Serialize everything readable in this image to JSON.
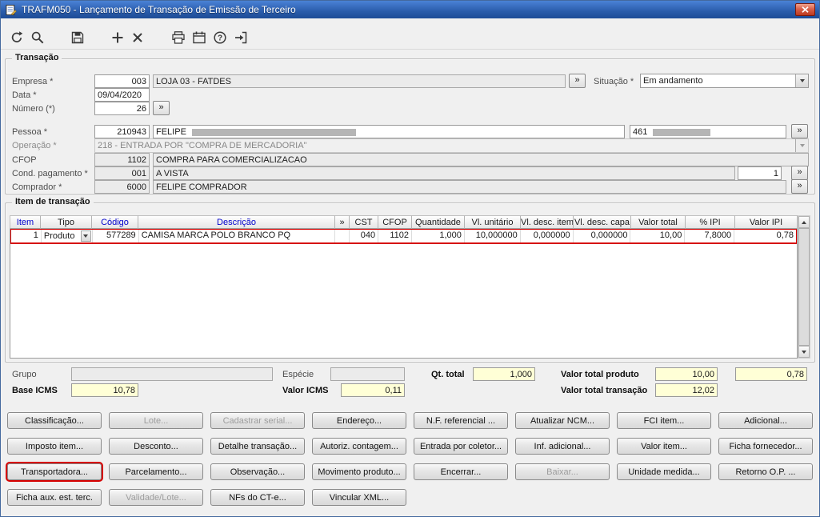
{
  "window": {
    "title": "TRAFM050 - Lançamento de Transação de Emissão de Terceiro"
  },
  "glyphs": {
    "expand": "»"
  },
  "toolbar": {
    "buttons": [
      "undo",
      "search",
      "save",
      "add",
      "delete",
      "print",
      "calendar",
      "help",
      "exit"
    ]
  },
  "transacao": {
    "legend": "Transação",
    "empresa": {
      "label": "Empresa *",
      "code": "003",
      "name": "LOJA 03 - FATDES"
    },
    "situacao": {
      "label": "Situação *",
      "value": "Em andamento"
    },
    "data": {
      "label": "Data *",
      "value": "09/04/2020"
    },
    "numero": {
      "label": "Número (*)",
      "value": "26"
    },
    "pessoa": {
      "label": "Pessoa *",
      "code": "210943",
      "name": "FELIPE",
      "doc": "461"
    },
    "operacao": {
      "label": "Operação *",
      "value": "218 - ENTRADA POR \"COMPRA DE MERCADORIA\""
    },
    "cfop": {
      "label": "CFOP",
      "code": "1102",
      "desc": "COMPRA PARA COMERCIALIZACAO"
    },
    "cond_pagamento": {
      "label": "Cond. pagamento *",
      "code": "001",
      "desc": "A VISTA",
      "parcelas": "1"
    },
    "comprador": {
      "label": "Comprador *",
      "code": "6000",
      "name": "FELIPE COMPRADOR"
    }
  },
  "itens": {
    "legend": "Item de transação",
    "columns": [
      {
        "label": "Item",
        "link": true
      },
      {
        "label": "Tipo",
        "link": false
      },
      {
        "label": "Código",
        "link": true
      },
      {
        "label": "Descrição",
        "link": true
      },
      {
        "label": "»",
        "link": false
      },
      {
        "label": "CST",
        "link": false
      },
      {
        "label": "CFOP",
        "link": false
      },
      {
        "label": "Quantidade",
        "link": false
      },
      {
        "label": "Vl. unitário",
        "link": false
      },
      {
        "label": "Vl. desc. item",
        "link": false
      },
      {
        "label": "Vl. desc. capa",
        "link": false
      },
      {
        "label": "Valor total",
        "link": false
      },
      {
        "label": "% IPI",
        "link": false
      },
      {
        "label": "Valor IPI",
        "link": false
      }
    ],
    "rows": [
      {
        "item": "1",
        "tipo": "Produto",
        "codigo": "577289",
        "descricao": "CAMISA MARCA POLO BRANCO PQ",
        "expand": "",
        "cst": "040",
        "cfop": "1102",
        "quantidade": "1,000",
        "vl_unitario": "10,000000",
        "vl_desc_item": "0,000000",
        "vl_desc_capa": "0,000000",
        "valor_total": "10,00",
        "pct_ipi": "7,8000",
        "valor_ipi": "0,78",
        "highlighted": true
      }
    ]
  },
  "totais": {
    "grupo_label": "Grupo",
    "grupo_value": "",
    "especie_label": "Espécie",
    "especie_value": "",
    "qt_total_label": "Qt. total",
    "qt_total": "1,000",
    "valor_total_produto_label": "Valor total produto",
    "valor_total_produto": "10,00",
    "valor_ipi_total": "0,78",
    "base_icms_label": "Base ICMS",
    "base_icms": "10,78",
    "valor_icms_label": "Valor ICMS",
    "valor_icms": "0,11",
    "valor_total_transacao_label": "Valor total transação",
    "valor_total_transacao": "12,02"
  },
  "actions": {
    "rows": [
      [
        {
          "label": "Classificação...",
          "enabled": true
        },
        {
          "label": "Lote...",
          "enabled": false
        },
        {
          "label": "Cadastrar serial...",
          "enabled": false
        },
        {
          "label": "Endereço...",
          "enabled": true
        },
        {
          "label": "N.F. referencial ...",
          "enabled": true
        },
        {
          "label": "Atualizar NCM...",
          "enabled": true
        },
        {
          "label": "FCI item...",
          "enabled": true
        },
        {
          "label": "Adicional...",
          "enabled": true
        }
      ],
      [
        {
          "label": "Imposto item...",
          "enabled": true
        },
        {
          "label": "Desconto...",
          "enabled": true
        },
        {
          "label": "Detalhe transação...",
          "enabled": true
        },
        {
          "label": "Autoriz. contagem...",
          "enabled": true
        },
        {
          "label": "Entrada por coletor...",
          "enabled": true
        },
        {
          "label": "Inf. adicional...",
          "enabled": true
        },
        {
          "label": "Valor item...",
          "enabled": true
        },
        {
          "label": "Ficha fornecedor...",
          "enabled": true
        }
      ],
      [
        {
          "label": "Transportadora...",
          "enabled": true,
          "highlight": true
        },
        {
          "label": "Parcelamento...",
          "enabled": true
        },
        {
          "label": "Observação...",
          "enabled": true
        },
        {
          "label": "Movimento produto...",
          "enabled": true
        },
        {
          "label": "Encerrar...",
          "enabled": true
        },
        {
          "label": "Baixar...",
          "enabled": false
        },
        {
          "label": "Unidade medida...",
          "enabled": true
        },
        {
          "label": "Retorno O.P. ...",
          "enabled": true
        }
      ],
      [
        {
          "label": "Ficha aux. est. terc.",
          "enabled": true
        },
        {
          "label": "Validade/Lote...",
          "enabled": false
        },
        {
          "label": "NFs do CT-e...",
          "enabled": true
        },
        {
          "label": "Vincular XML...",
          "enabled": true
        }
      ]
    ]
  },
  "colors": {
    "highlight_red": "#d60000",
    "titlebar_blue": "#2a5cab",
    "field_yellow": "#ffffd6",
    "header_link_blue": "#0000cc"
  }
}
